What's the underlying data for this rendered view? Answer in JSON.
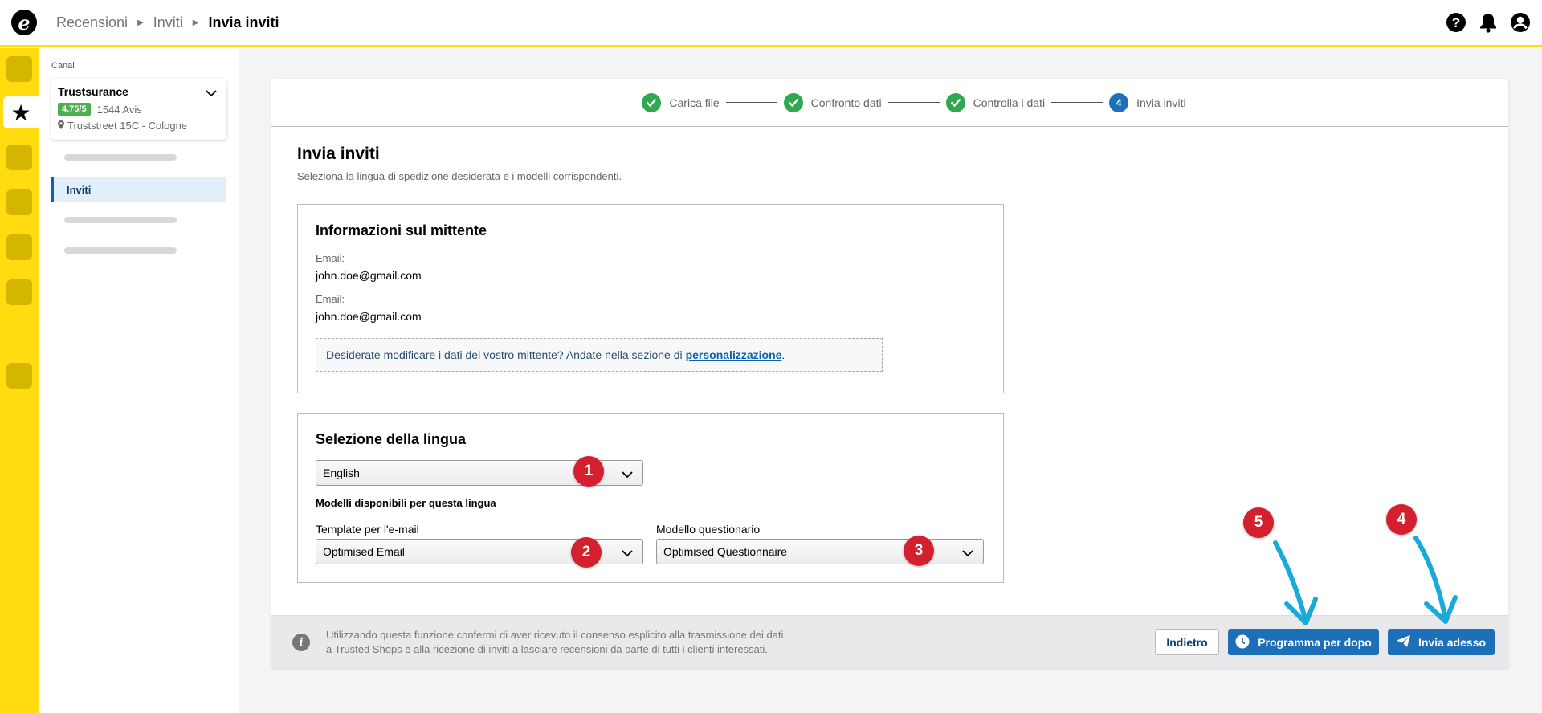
{
  "breadcrumb": [
    "Recensioni",
    "Inviti",
    "Invia inviti"
  ],
  "icons": {
    "logo": "trusted-shops-e-logo",
    "help": "help-icon",
    "bell": "bell-icon",
    "user": "user-icon"
  },
  "sidebar": {
    "canal_label": "Canal",
    "shop": {
      "name": "Trustsurance",
      "rating": "4.75/5",
      "reviews": "1544 Avis",
      "address": "Truststreet 15C - Cologne"
    },
    "active_item": "Inviti"
  },
  "stepper": [
    {
      "label": "Carica file",
      "state": "done"
    },
    {
      "label": "Confronto dati",
      "state": "done"
    },
    {
      "label": "Controlla i dati",
      "state": "done"
    },
    {
      "label": "Invia inviti",
      "state": "current",
      "number": "4"
    }
  ],
  "page": {
    "title": "Invia inviti",
    "subtitle": "Seleziona la lingua di spedizione desiderata e i modelli corrispondenti."
  },
  "sender": {
    "title": "Informazioni sul mittente",
    "fields": [
      {
        "label": "Email:",
        "value": "john.doe@gmail.com"
      },
      {
        "label": "Email:",
        "value": "john.doe@gmail.com"
      }
    ],
    "notice_text": "Desiderate modificare i dati del vostro mittente? Andate nella sezione di",
    "notice_link": "personalizzazione",
    "notice_end": "."
  },
  "language": {
    "title": "Selezione della lingua",
    "selected": "English",
    "templates_heading": "Modelli disponibili per questa lingua",
    "email_template_label": "Template per l'e-mail",
    "email_template_value": "Optimised Email",
    "questionnaire_label": "Modello questionario",
    "questionnaire_value": "Optimised Questionnaire"
  },
  "footer": {
    "legal_line1": "Utilizzando questa funzione confermi di aver ricevuto il consenso esplicito alla trasmissione dei dati",
    "legal_line2": "a Trusted Shops e alla ricezione di inviti a lasciare recensioni da parte di tutti i clienti interessati.",
    "back_label": "Indietro",
    "later_label": "Programma per dopo",
    "now_label": "Invia adesso"
  },
  "markers": [
    "1",
    "2",
    "3",
    "4",
    "5"
  ],
  "colors": {
    "accent_yellow": "#ffdc0f",
    "primary_blue": "#1d6fb8",
    "success_green": "#2fa84f",
    "marker_red": "#d4202e",
    "arrow_cyan": "#1aaad8"
  }
}
